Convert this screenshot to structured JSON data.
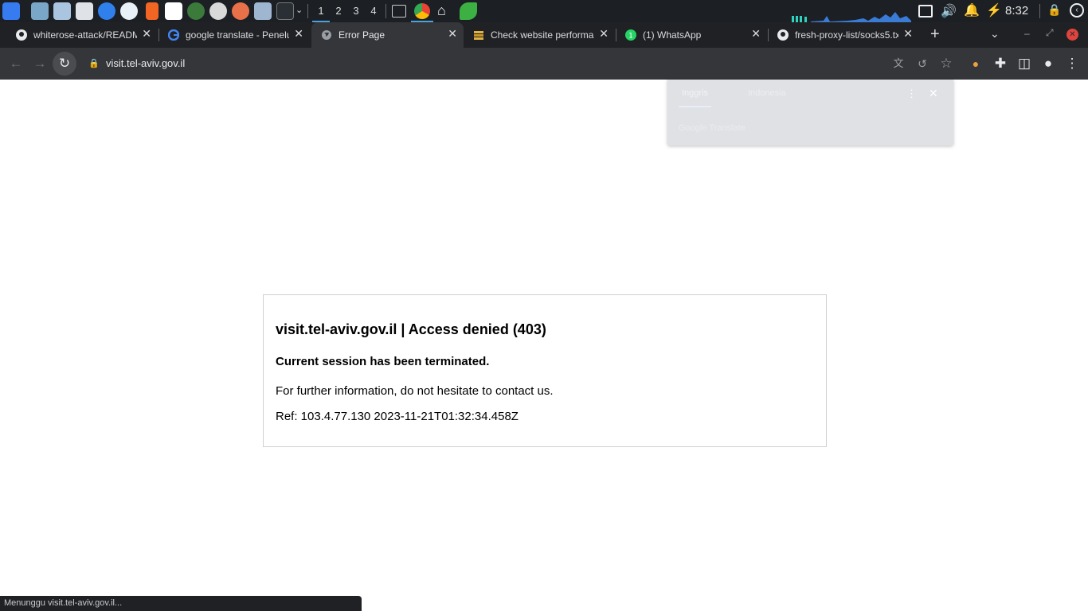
{
  "panel": {
    "workspaces": [
      "1",
      "2",
      "3",
      "4"
    ],
    "clock": "8:32"
  },
  "tabs": [
    {
      "title": "whiterose-attack/README",
      "icon": "github-icon"
    },
    {
      "title": "google translate - Penelu",
      "icon": "google-icon"
    },
    {
      "title": "Error Page",
      "icon": "globe-icon"
    },
    {
      "title": "Check website performan",
      "icon": "site-icon"
    },
    {
      "title": "(1) WhatsApp",
      "icon": "whatsapp-icon"
    },
    {
      "title": "fresh-proxy-list/socks5.tx",
      "icon": "github-icon"
    }
  ],
  "toolbar": {
    "url": "visit.tel-aviv.gov.il"
  },
  "translate_popup": {
    "source_lang": "Inggris",
    "target_lang": "Indonesia",
    "brand": "Google Translate"
  },
  "error": {
    "heading": "visit.tel-aviv.gov.il | Access denied (403)",
    "subheading": "Current session has been terminated.",
    "message": "For further information, do not hesitate to contact us.",
    "ref": "Ref: 103.4.77.130 2023-11-21T01:32:34.458Z"
  },
  "status": "Menunggu visit.tel-aviv.gov.il..."
}
